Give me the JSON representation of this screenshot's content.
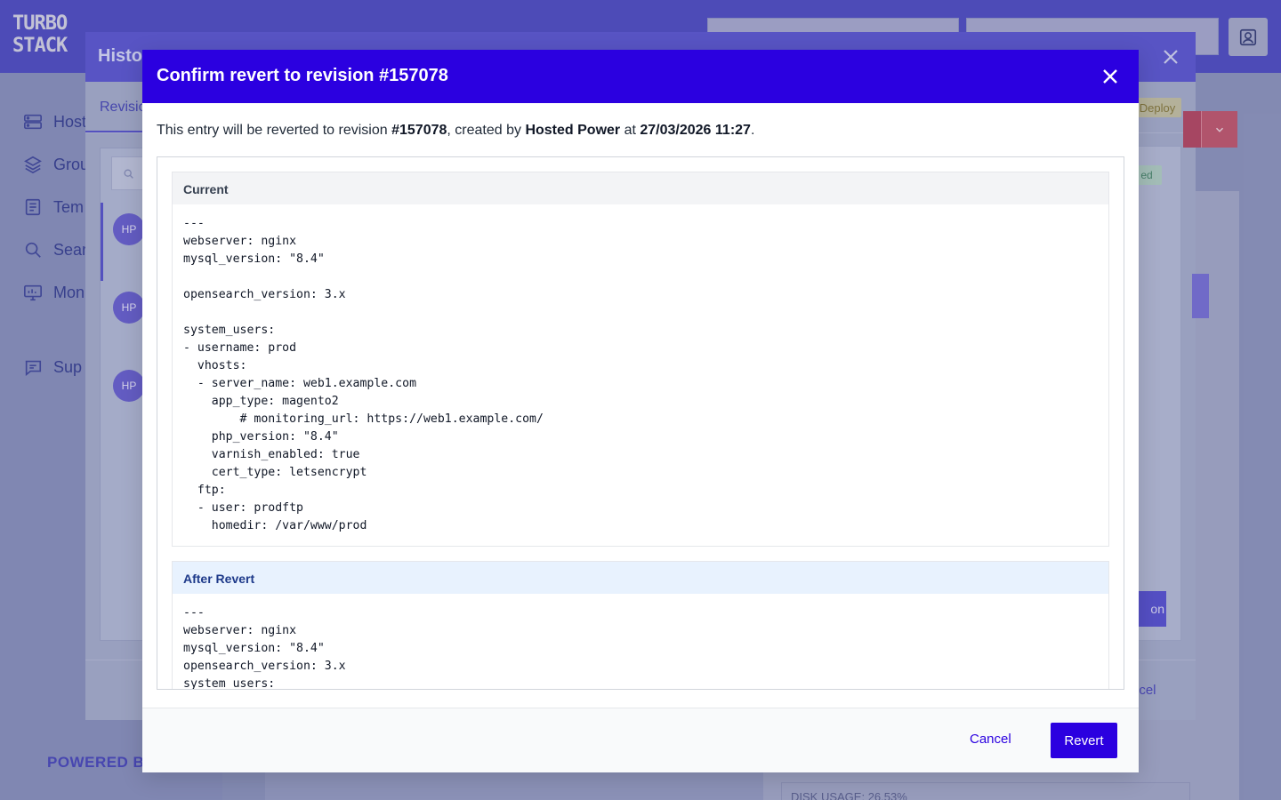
{
  "app": {
    "logo_lines": [
      "TURBO",
      "STACK"
    ],
    "powered_by": "POWERED B",
    "sidebar": [
      {
        "label": "Host",
        "icon": "server-icon"
      },
      {
        "label": "Grou",
        "icon": "layers-icon"
      },
      {
        "label": "Tem",
        "icon": "document-icon"
      },
      {
        "label": "Sear",
        "icon": "search-icon"
      },
      {
        "label": "Mon",
        "icon": "monitor-icon"
      },
      {
        "label": "Sup",
        "icon": "chat-icon"
      }
    ],
    "disk_usage_text": "DISK USAGE: 26.53%"
  },
  "history_modal": {
    "title": "Histo",
    "tab_label": "Revisio",
    "deploy_badge": "Deploy",
    "status_badge": "ed",
    "action_button_label": "on",
    "cancel_label": "ncel",
    "avatars": [
      "HP",
      "HP",
      "HP"
    ]
  },
  "confirm_modal": {
    "title": "Confirm revert to revision #157078",
    "intro": {
      "part1": "This entry will be reverted to revision ",
      "revision": "#157078",
      "part2": ", created by ",
      "author": "Hosted Power",
      "part3": " at ",
      "datetime": "27/03/2026 11:27",
      "part4": "."
    },
    "current": {
      "heading": "Current",
      "lines": [
        "---",
        "webserver: nginx",
        "mysql_version: \"8.4\"",
        "",
        "opensearch_version: 3.x",
        "",
        "system_users:",
        "- username: prod",
        "  vhosts:",
        "  - server_name: web1.example.com",
        "    app_type: magento2",
        "        # monitoring_url: https://web1.example.com/",
        "    php_version: \"8.4\"",
        "    varnish_enabled: true",
        "    cert_type: letsencrypt",
        "  ftp:",
        "  - user: prodftp",
        "    homedir: /var/www/prod"
      ]
    },
    "after": {
      "heading": "After Revert",
      "lines": [
        "---",
        "webserver: nginx",
        "mysql_version: \"8.4\"",
        "opensearch_version: 3.x",
        "system_users:"
      ]
    },
    "buttons": {
      "cancel": "Cancel",
      "revert": "Revert"
    }
  }
}
